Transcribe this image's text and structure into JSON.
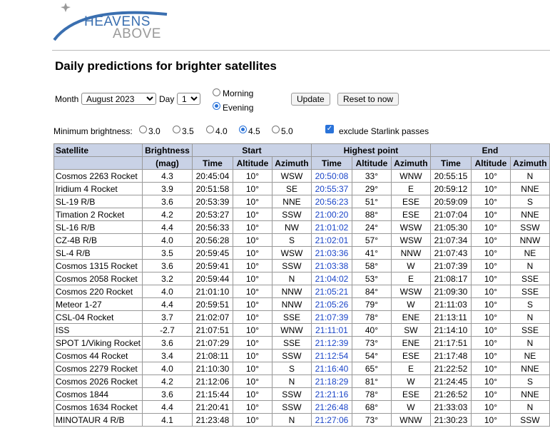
{
  "brand": {
    "line1": "HEAVENS",
    "line2": "ABOVE",
    "icon": "satellite-orbit-logo"
  },
  "title": "Daily predictions for brighter satellites",
  "controls": {
    "month_label": "Month",
    "month_value": "August 2023",
    "day_label": "Day",
    "day_value": "1",
    "morning_label": "Morning",
    "evening_label": "Evening",
    "selected_time": "Evening",
    "update_label": "Update",
    "reset_label": "Reset to now",
    "brightness_label": "Minimum brightness:",
    "brightness_options": [
      "3.0",
      "3.5",
      "4.0",
      "4.5",
      "5.0"
    ],
    "brightness_selected": "4.5",
    "exclude_label": "exclude Starlink passes",
    "exclude_checked": true
  },
  "table": {
    "headers": {
      "satellite": "Satellite",
      "brightness": "Brightness",
      "mag": "(mag)",
      "start": "Start",
      "highest": "Highest point",
      "end": "End",
      "time": "Time",
      "altitude": "Altitude",
      "azimuth": "Azimuth"
    },
    "rows": [
      [
        "Cosmos 2263 Rocket",
        "4.3",
        "20:45:04",
        "10°",
        "WSW",
        "20:50:08",
        "33°",
        "WNW",
        "20:55:15",
        "10°",
        "N"
      ],
      [
        "Iridium 4 Rocket",
        "3.9",
        "20:51:58",
        "10°",
        "SE",
        "20:55:37",
        "29°",
        "E",
        "20:59:12",
        "10°",
        "NNE"
      ],
      [
        "SL-19 R/B",
        "3.6",
        "20:53:39",
        "10°",
        "NNE",
        "20:56:23",
        "51°",
        "ESE",
        "20:59:09",
        "10°",
        "S"
      ],
      [
        "Timation 2 Rocket",
        "4.2",
        "20:53:27",
        "10°",
        "SSW",
        "21:00:20",
        "88°",
        "ESE",
        "21:07:04",
        "10°",
        "NNE"
      ],
      [
        "SL-16 R/B",
        "4.4",
        "20:56:33",
        "10°",
        "NW",
        "21:01:02",
        "24°",
        "WSW",
        "21:05:30",
        "10°",
        "SSW"
      ],
      [
        "CZ-4B R/B",
        "4.0",
        "20:56:28",
        "10°",
        "S",
        "21:02:01",
        "57°",
        "WSW",
        "21:07:34",
        "10°",
        "NNW"
      ],
      [
        "SL-4 R/B",
        "3.5",
        "20:59:45",
        "10°",
        "WSW",
        "21:03:36",
        "41°",
        "NNW",
        "21:07:43",
        "10°",
        "NE"
      ],
      [
        "Cosmos 1315 Rocket",
        "3.6",
        "20:59:41",
        "10°",
        "SSW",
        "21:03:38",
        "58°",
        "W",
        "21:07:39",
        "10°",
        "N"
      ],
      [
        "Cosmos 2058 Rocket",
        "3.2",
        "20:59:44",
        "10°",
        "N",
        "21:04:02",
        "53°",
        "E",
        "21:08:17",
        "10°",
        "SSE"
      ],
      [
        "Cosmos 220 Rocket",
        "4.0",
        "21:01:10",
        "10°",
        "NNW",
        "21:05:21",
        "84°",
        "WSW",
        "21:09:30",
        "10°",
        "SSE"
      ],
      [
        "Meteor 1-27",
        "4.4",
        "20:59:51",
        "10°",
        "NNW",
        "21:05:26",
        "79°",
        "W",
        "21:11:03",
        "10°",
        "S"
      ],
      [
        "CSL-04 Rocket",
        "3.7",
        "21:02:07",
        "10°",
        "SSE",
        "21:07:39",
        "78°",
        "ENE",
        "21:13:11",
        "10°",
        "N"
      ],
      [
        "ISS",
        "-2.7",
        "21:07:51",
        "10°",
        "WNW",
        "21:11:01",
        "40°",
        "SW",
        "21:14:10",
        "10°",
        "SSE"
      ],
      [
        "SPOT 1/Viking Rocket",
        "3.6",
        "21:07:29",
        "10°",
        "SSE",
        "21:12:39",
        "73°",
        "ENE",
        "21:17:51",
        "10°",
        "N"
      ],
      [
        "Cosmos 44 Rocket",
        "3.4",
        "21:08:11",
        "10°",
        "SSW",
        "21:12:54",
        "54°",
        "ESE",
        "21:17:48",
        "10°",
        "NE"
      ],
      [
        "Cosmos 2279 Rocket",
        "4.0",
        "21:10:30",
        "10°",
        "S",
        "21:16:40",
        "65°",
        "E",
        "21:22:52",
        "10°",
        "NNE"
      ],
      [
        "Cosmos 2026 Rocket",
        "4.2",
        "21:12:06",
        "10°",
        "N",
        "21:18:29",
        "81°",
        "W",
        "21:24:45",
        "10°",
        "S"
      ],
      [
        "Cosmos 1844",
        "3.6",
        "21:15:44",
        "10°",
        "SSW",
        "21:21:16",
        "78°",
        "ESE",
        "21:26:52",
        "10°",
        "NNE"
      ],
      [
        "Cosmos 1634 Rocket",
        "4.4",
        "21:20:41",
        "10°",
        "SSW",
        "21:26:48",
        "68°",
        "W",
        "21:33:03",
        "10°",
        "N"
      ],
      [
        "MINOTAUR 4 R/B",
        "4.1",
        "21:23:48",
        "10°",
        "N",
        "21:27:06",
        "73°",
        "WNW",
        "21:30:23",
        "10°",
        "SSW"
      ]
    ]
  }
}
